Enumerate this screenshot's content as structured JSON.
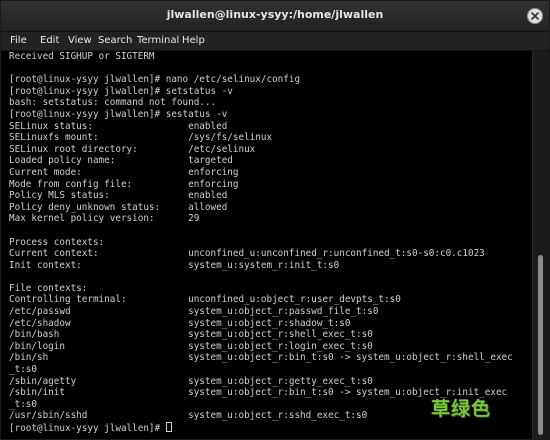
{
  "window": {
    "title": "jlwallen@linux-ysyy:/home/jlwallen"
  },
  "menu": [
    "File",
    "Edit",
    "View",
    "Search",
    "Terminal",
    "Help"
  ],
  "terminal": {
    "lines": [
      "Received SIGHUP or SIGTERM",
      "",
      "[root@linux-ysyy jlwallen]# nano /etc/selinux/config",
      "[root@linux-ysyy jlwallen]# setstatus -v",
      "bash: setstatus: command not found...",
      "[root@linux-ysyy jlwallen]# sestatus -v",
      "SELinux status:                 enabled",
      "SELinuxfs mount:                /sys/fs/selinux",
      "SELinux root directory:         /etc/selinux",
      "Loaded policy name:             targeted",
      "Current mode:                   enforcing",
      "Mode from config file:          enforcing",
      "Policy MLS status:              enabled",
      "Policy deny_unknown status:     allowed",
      "Max kernel policy version:      29",
      "",
      "Process contexts:",
      "Current context:                unconfined_u:unconfined_r:unconfined_t:s0-s0:c0.c1023",
      "Init context:                   system_u:system_r:init_t:s0",
      "",
      "File contexts:",
      "Controlling terminal:           unconfined_u:object_r:user_devpts_t:s0",
      "/etc/passwd                     system_u:object_r:passwd_file_t:s0",
      "/etc/shadow                     system_u:object_r:shadow_t:s0",
      "/bin/bash                       system_u:object_r:shell_exec_t:s0",
      "/bin/login                      system_u:object_r:login_exec_t:s0",
      "/bin/sh                         system_u:object_r:bin_t:s0 -> system_u:object_r:shell_exec",
      "_t:s0",
      "/sbin/agetty                    system_u:object_r:getty_exec_t:s0",
      "/sbin/init                      system_u:object_r:bin_t:s0 -> system_u:object_r:init_exec",
      "_t:s0",
      "/usr/sbin/sshd                  system_u:object_r:sshd_exec_t:s0"
    ],
    "prompt": "[root@linux-ysyy jlwallen]# "
  },
  "watermark": "草绿色"
}
